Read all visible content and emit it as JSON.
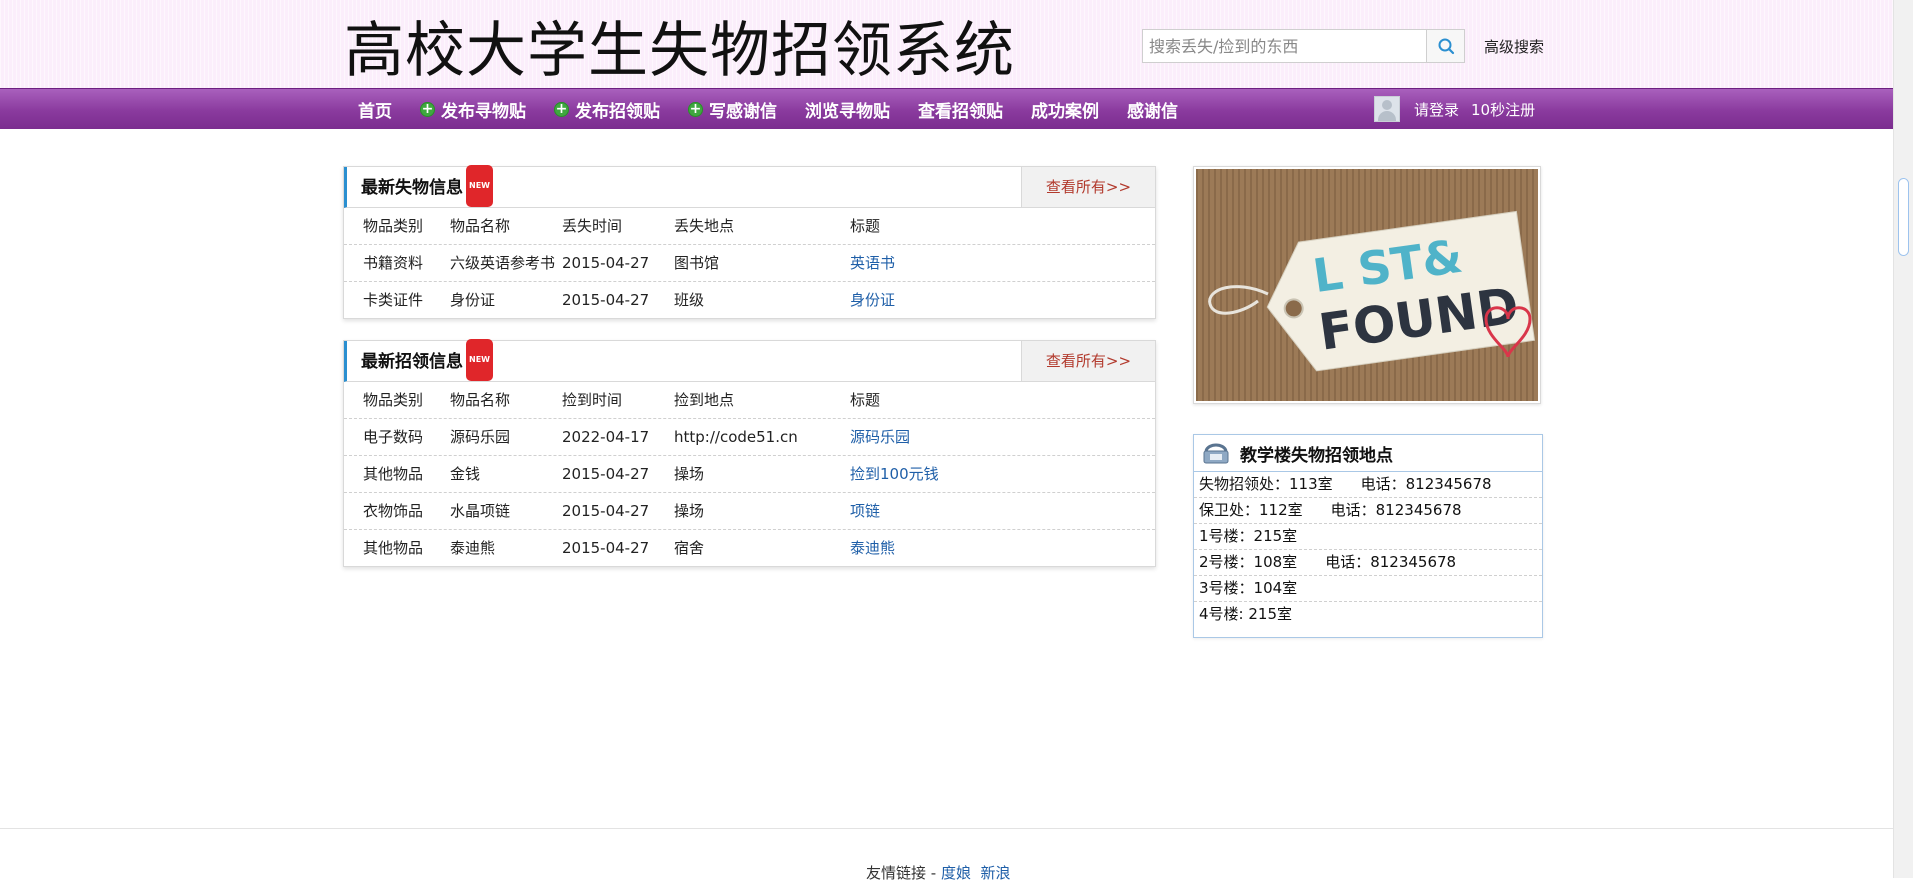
{
  "header": {
    "site_title": "高校大学生失物招领系统",
    "search_placeholder": "搜索丢失/捡到的东西",
    "advanced_search": "高级搜索"
  },
  "nav": {
    "items": [
      {
        "label": "首页",
        "icon": ""
      },
      {
        "label": "发布寻物贴",
        "icon": "plus-icon"
      },
      {
        "label": "发布招领贴",
        "icon": "plus-icon"
      },
      {
        "label": "写感谢信",
        "icon": "plus-icon"
      },
      {
        "label": "浏览寻物贴",
        "icon": ""
      },
      {
        "label": "查看招领贴",
        "icon": ""
      },
      {
        "label": "成功案例",
        "icon": ""
      },
      {
        "label": "感谢信",
        "icon": ""
      }
    ],
    "login": "请登录",
    "register": "10秒注册"
  },
  "lost_panel": {
    "title": "最新失物信息",
    "badge": "NEW",
    "view_all": "查看所有>>",
    "headers": [
      "物品类别",
      "物品名称",
      "丢失时间",
      "丢失地点",
      "标题"
    ],
    "rows": [
      [
        "书籍资料",
        "六级英语参考书",
        "2015-04-27",
        "图书馆",
        "英语书"
      ],
      [
        "卡类证件",
        "身份证",
        "2015-04-27",
        "班级",
        "身份证"
      ]
    ]
  },
  "found_panel": {
    "title": "最新招领信息",
    "badge": "NEW",
    "view_all": "查看所有>>",
    "headers": [
      "物品类别",
      "物品名称",
      "捡到时间",
      "捡到地点",
      "标题"
    ],
    "rows": [
      [
        "电子数码",
        "源码乐园",
        "2022-04-17",
        "http://code51.cn",
        "源码乐园"
      ],
      [
        "其他物品",
        "金钱",
        "2015-04-27",
        "操场",
        "捡到100元钱"
      ],
      [
        "衣物饰品",
        "水晶项链",
        "2015-04-27",
        "操场",
        "项链"
      ],
      [
        "其他物品",
        "泰迪熊",
        "2015-04-27",
        "宿舍",
        "泰迪熊"
      ]
    ]
  },
  "banner": {
    "line1": "L  ST&",
    "line2": "FOUND"
  },
  "locations": {
    "title": "教学楼失物招领地点",
    "items": [
      {
        "place": "失物招领处：113室",
        "phone": "电话：812345678"
      },
      {
        "place": "保卫处：112室",
        "phone": "电话：812345678"
      },
      {
        "place": "1号楼：215室",
        "phone": ""
      },
      {
        "place": "2号楼：108室",
        "phone": "电话：812345678"
      },
      {
        "place": "3号楼：104室",
        "phone": ""
      },
      {
        "place": "4号楼: 215室",
        "phone": ""
      }
    ]
  },
  "footer": {
    "label": "友情链接 - ",
    "links": [
      "度娘",
      "新浪"
    ]
  },
  "colors": {
    "nav_purple": "#8a3a9e",
    "header_bg": "#fbeefb",
    "link_blue": "#1f5fa8",
    "accent_blue": "#2a8fd0"
  }
}
